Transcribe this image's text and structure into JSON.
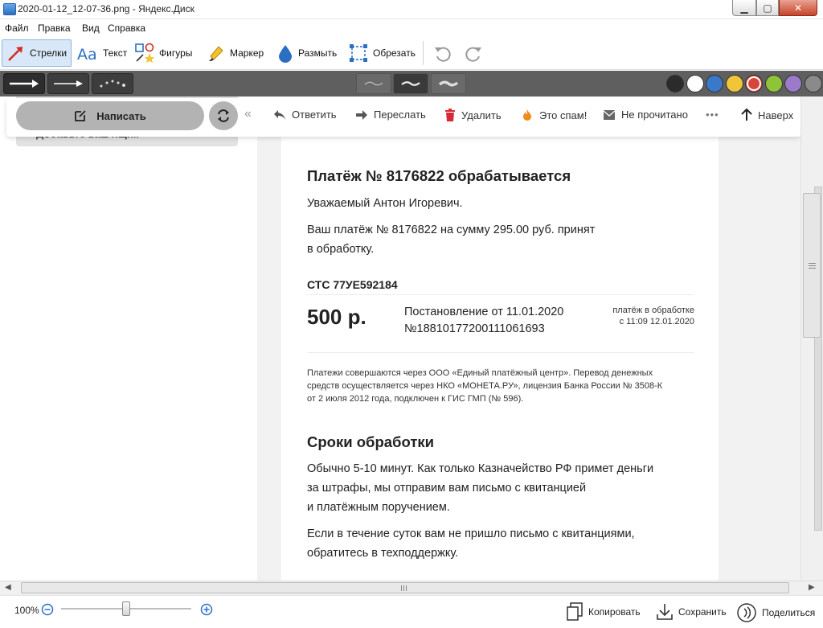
{
  "window": {
    "title": "2020-01-12_12-07-36.png - Яндекс.Диск",
    "close_glyph": "✕"
  },
  "menu": {
    "items": [
      "Файл",
      "Правка",
      "Вид",
      "Справка"
    ]
  },
  "toolbar": {
    "tools": [
      {
        "label": "Стрелки",
        "icon": "arrow-tool-icon",
        "active": true
      },
      {
        "label": "Текст",
        "icon": "text-tool-icon"
      },
      {
        "label": "Фигуры",
        "icon": "shapes-tool-icon"
      },
      {
        "label": "Маркер",
        "icon": "marker-tool-icon"
      },
      {
        "label": "Размыть",
        "icon": "blur-tool-icon"
      },
      {
        "label": "Обрезать",
        "icon": "crop-tool-icon"
      }
    ],
    "undo_icon": "undo-icon",
    "redo_icon": "redo-icon"
  },
  "stylebar": {
    "arrow_styles": [
      "straight-arrow",
      "thin-arrow",
      "dotted-arrow"
    ],
    "stroke_widths": [
      "thin",
      "medium",
      "thick"
    ],
    "colors": [
      "#2b2b2b",
      "#ffffff",
      "#3a78c9",
      "#f1c53a",
      "#d7453a",
      "#8fc33a",
      "#9a7ac9",
      "#8a8a8a"
    ],
    "selected_color": "#d7453a"
  },
  "mail": {
    "sidebar_peek": "Добавьте ваш ящик",
    "compose_label": "Написать",
    "actions": [
      "Ответить",
      "Переслать",
      "Удалить",
      "Это спам!",
      "Не прочитано",
      "•••",
      "Наверх"
    ],
    "heading": "Платёж № 8176822 обрабатывается",
    "greeting": "Уважаемый Антон Игоревич.",
    "accepted_line1": "Ваш платёж № 8176822 на сумму 295.00 руб. принят",
    "accepted_line2": "в обработку.",
    "cert_label": "СТС 77УЕ592184",
    "fine_amount": "500 р.",
    "decree_line1": "Постановление от 11.01.2020",
    "decree_line2": "№18810177200111061693",
    "status_line1": "платёж в обработке",
    "status_line2": "с 11:09 12.01.2020",
    "note_lines": [
      "Платежи совершаются через ООО «Единый платёжный центр». Перевод денежных",
      "средств осуществляется через НКО «МОНЕТА.РУ», лицензия Банка России № 3508-К",
      "от 2 июля 2012 года, подключен к ГИС ГМП (№ 596)."
    ],
    "terms_heading": "Сроки обработки",
    "terms_lines": [
      "Обычно 5-10 минут. Как только Казначейство РФ примет деньги",
      "за штрафы, мы отправим вам письмо с квитанцией",
      "и платёжным поручением."
    ],
    "support_lines": [
      "Если в течение суток вам не пришло письмо с квитанциями,",
      "обратитесь в техподдержку."
    ]
  },
  "bottombar": {
    "zoom": "100%",
    "zoom_slider_fraction": 0.5,
    "copy_label": "Копировать",
    "save_label": "Сохранить",
    "share_label": "Поделиться"
  }
}
